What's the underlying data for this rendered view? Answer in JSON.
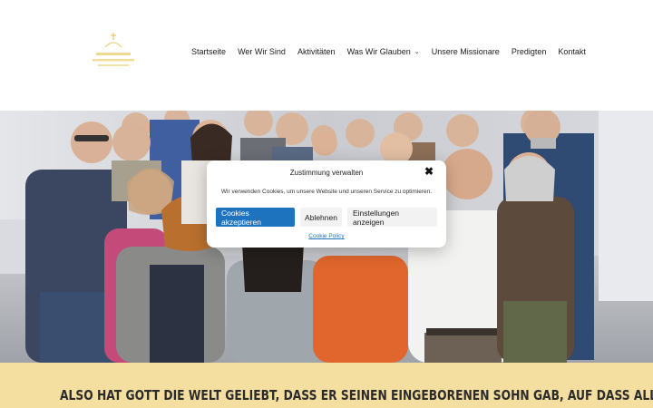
{
  "nav": {
    "items": [
      {
        "label": "Startseite"
      },
      {
        "label": "Wer Wir Sind"
      },
      {
        "label": "Aktivitäten"
      },
      {
        "label": "Was Wir Glauben",
        "has_dropdown": true
      },
      {
        "label": "Unsere Missionare"
      },
      {
        "label": "Predigten"
      },
      {
        "label": "Kontakt"
      }
    ],
    "dropdown_icon": "chevron-down-icon"
  },
  "banner": {
    "text": "Also hat Gott die Welt geliebt, dass er seinen eingeborenen Sohn gab, auf dass alle, die"
  },
  "cookie_modal": {
    "title": "Zustimmung verwalten",
    "close_icon": "close-icon",
    "body": "Wir verwenden Cookies, um unsere Website und unseren Service zu optimieren.",
    "accept_label": "Cookies akzeptieren",
    "deny_label": "Ablehnen",
    "settings_label": "Einstellungen anzeigen",
    "policy_link": "Cookie Policy"
  },
  "colors": {
    "accent": "#1e73be",
    "banner_bg": "#f4dfa0",
    "logo_gold": "#e8c766"
  }
}
